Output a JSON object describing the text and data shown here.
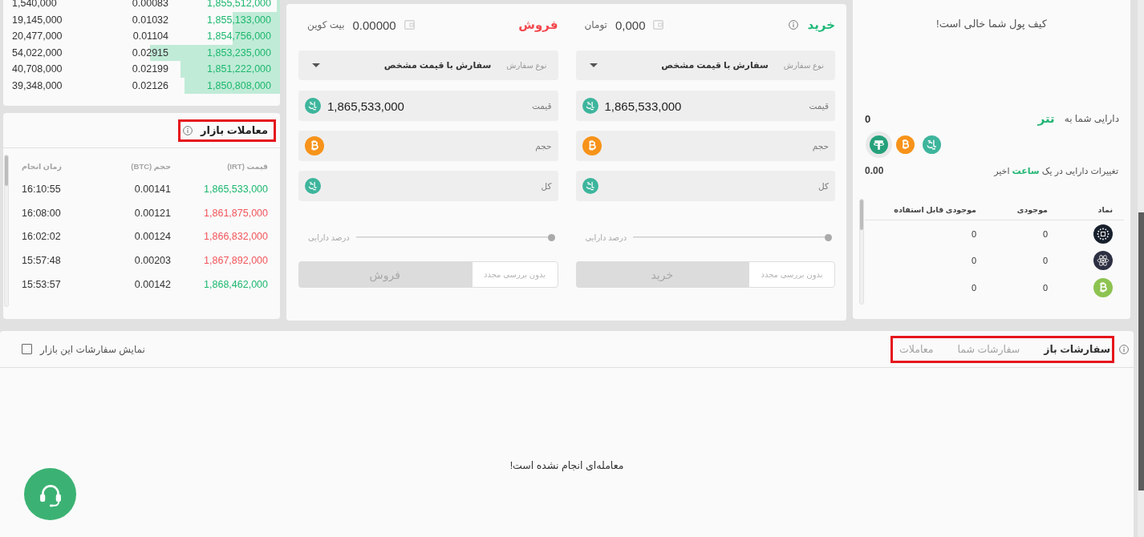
{
  "wallet": {
    "empty_message": "کیف پول شما خالی است!",
    "holdings_label": "دارایی شما به",
    "holdings_currency": "تتر",
    "holdings_value": "0",
    "currencies": [
      {
        "kind": "toman",
        "selected": false
      },
      {
        "kind": "btc",
        "selected": false
      },
      {
        "kind": "usdt",
        "selected": true
      }
    ],
    "change_label": "تغییرات دارایی در یک **ساعت** اخیر",
    "change_value": "0.00",
    "table": {
      "columns": [
        "نماد",
        "موجودی",
        "موجودی قابل استفاده"
      ],
      "rows": [
        {
          "kind": "dots",
          "balance": "0",
          "available": "0"
        },
        {
          "kind": "atom",
          "balance": "0",
          "available": "0"
        },
        {
          "kind": "bch",
          "balance": "0",
          "available": "0"
        }
      ]
    }
  },
  "order_forms": [
    {
      "kind": "buy",
      "title": "خرید",
      "info": true,
      "balance": "0,000",
      "balance_unit": "تومان",
      "order_type": {
        "label": "نوع سفارش",
        "value": "سفارش با قیمت مشخص"
      },
      "fields": [
        {
          "label": "قیمت",
          "value": "1,865,533,000",
          "kind": "toman"
        },
        {
          "label": "حجم",
          "kind": "btc"
        },
        {
          "label": "کل",
          "kind": "toman"
        }
      ],
      "slider": {
        "label": "درصد دارایی",
        "level": 0
      },
      "confirm_toggle": "بدون بررسی مجدد",
      "submit": {
        "label": "خرید",
        "disabled": true
      }
    },
    {
      "kind": "sell",
      "title": "فروش",
      "info": false,
      "balance": "0.00000",
      "balance_unit": "بیت کوین",
      "order_type": {
        "label": "نوع سفارش",
        "value": "سفارش با قیمت مشخص"
      },
      "fields": [
        {
          "label": "قیمت",
          "value": "1,865,533,000",
          "kind": "toman"
        },
        {
          "label": "حجم",
          "kind": "btc"
        },
        {
          "label": "کل",
          "kind": "toman"
        }
      ],
      "slider": {
        "label": "درصد دارایی",
        "level": 0
      },
      "confirm_toggle": "بدون بررسی مجدد",
      "submit": {
        "label": "فروش",
        "disabled": true
      }
    }
  ],
  "order_book": {
    "rows": [
      {
        "total": "1,540,000",
        "amount": "0.00083",
        "price": "1,855,512,000",
        "level": 0.012
      },
      {
        "total": "19,145,000",
        "amount": "0.01032",
        "price": "1,855,133,000",
        "level": 0.17
      },
      {
        "total": "20,477,000",
        "amount": "0.01104",
        "price": "1,854,756,000",
        "level": 0.17
      },
      {
        "total": "54,022,000",
        "amount": "0.02915",
        "price": "1,853,235,000",
        "level": 0.47
      },
      {
        "total": "40,708,000",
        "amount": "0.02199",
        "price": "1,851,222,000",
        "level": 0.36
      },
      {
        "total": "39,348,000",
        "amount": "0.02126",
        "price": "1,850,808,000",
        "level": 0.345
      }
    ]
  },
  "market_trades": {
    "title": "معاملات بازار",
    "highlighted": true,
    "columns": [
      "قیمت (IRT)",
      "حجم (BTC)",
      "زمان انجام"
    ],
    "rows": [
      {
        "price": "1,865,533,000",
        "volume": "0.00141",
        "time": "16:10:55",
        "kind": "buy"
      },
      {
        "price": "1,861,875,000",
        "volume": "0.00121",
        "time": "16:08:00",
        "kind": "sell"
      },
      {
        "price": "1,866,832,000",
        "volume": "0.00124",
        "time": "16:02:02",
        "kind": "sell"
      },
      {
        "price": "1,867,892,000",
        "volume": "0.00203",
        "time": "15:57:48",
        "kind": "sell"
      },
      {
        "price": "1,868,462,000",
        "volume": "0.00142",
        "time": "15:53:57",
        "kind": "buy"
      }
    ]
  },
  "orders_panel": {
    "tabs": [
      {
        "label": "سفارشات باز",
        "selected": true
      },
      {
        "label": "سفارشات شما",
        "selected": false
      },
      {
        "label": "معاملات",
        "selected": false
      }
    ],
    "tabs_highlighted": true,
    "filter": {
      "label": "نمایش سفارشات این بازار",
      "checked": false
    },
    "empty_message": "معامله‌ای انجام نشده است!"
  }
}
